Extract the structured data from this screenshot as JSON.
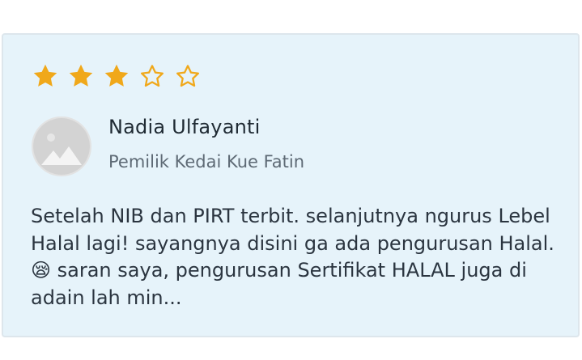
{
  "review_card": {
    "rating": 3,
    "rating_max": 5,
    "star_filled_color": "#f0a81a",
    "star_empty_color": "#f0a81a",
    "avatar_icon": "placeholder-avatar-icon",
    "reviewer_name": "Nadia Ulfayanti",
    "reviewer_role": "Pemilik Kedai Kue Fatin",
    "review_text": "Setelah NIB dan PIRT terbit. selanjutnya ngurus Lebel Halal lagi! sayangnya disini ga ada pengurusan Halal. 😪 saran saya, pengurusan Sertifikat HALAL juga di adain lah min..."
  }
}
